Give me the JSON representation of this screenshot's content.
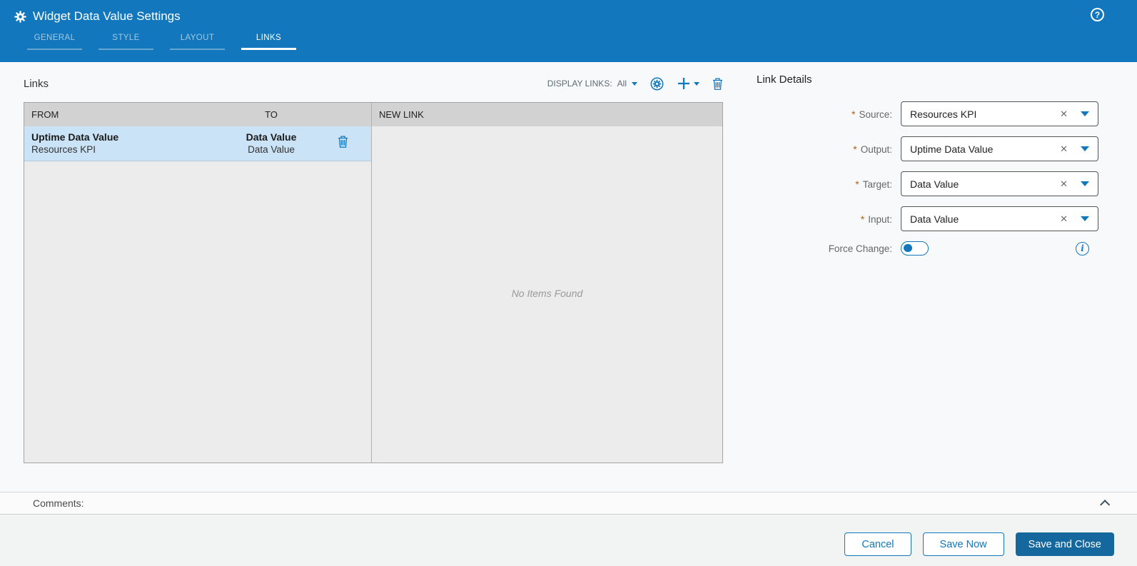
{
  "header": {
    "title": "Widget Data Value Settings",
    "tabs": [
      {
        "label": "GENERAL",
        "active": false
      },
      {
        "label": "STYLE",
        "active": false
      },
      {
        "label": "LAYOUT",
        "active": false
      },
      {
        "label": "LINKS",
        "active": true
      }
    ],
    "help_glyph": "?"
  },
  "links": {
    "title": "Links",
    "display_links_label": "DISPLAY LINKS:",
    "display_links_value": "All",
    "table": {
      "columns": {
        "from": "FROM",
        "to": "TO",
        "new_link": "NEW LINK"
      },
      "rows": [
        {
          "from_primary": "Uptime Data Value",
          "from_secondary": "Resources KPI",
          "to_primary": "Data Value",
          "to_secondary": "Data Value",
          "selected": true
        }
      ],
      "empty_text": "No Items Found"
    }
  },
  "details": {
    "title": "Link Details",
    "required_marker": "*",
    "clear_glyph": "✕",
    "fields": [
      {
        "label": "Source:",
        "value": "Resources KPI",
        "required": true
      },
      {
        "label": "Output:",
        "value": "Uptime Data Value",
        "required": true
      },
      {
        "label": "Target:",
        "value": "Data Value",
        "required": true
      },
      {
        "label": "Input:",
        "value": "Data Value",
        "required": true
      }
    ],
    "force_change_label": "Force Change:",
    "force_change_on": false,
    "info_glyph": "i"
  },
  "comments": {
    "label": "Comments:"
  },
  "footer": {
    "cancel_label": "Cancel",
    "save_now_label": "Save Now",
    "save_and_close_label": "Save and Close"
  },
  "icons": {
    "header_gear": "gear-icon",
    "help": "help-circle-icon",
    "auto_link": "gear-circle-icon",
    "add": "plus-icon",
    "delete": "trash-icon",
    "collapse": "chevron-up-icon",
    "info": "info-circle-icon"
  },
  "colors": {
    "header_blue": "#1277bd",
    "accent_blue": "#1277bd",
    "primary_button": "#15689d",
    "selected_row": "#cbe3f6",
    "table_header": "#d2d2d2",
    "table_body": "#ececec"
  }
}
